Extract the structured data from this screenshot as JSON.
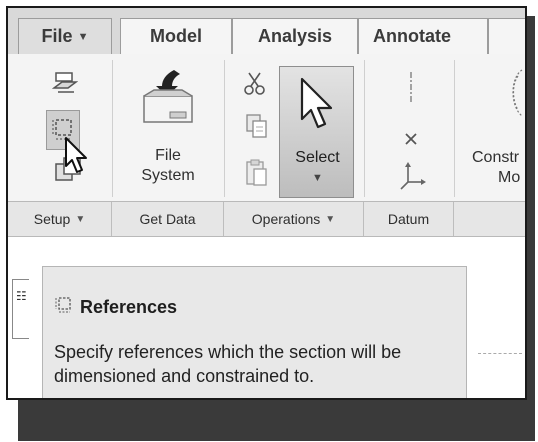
{
  "tabs": [
    {
      "label": "File",
      "has_dropdown": true
    },
    {
      "label": "Model"
    },
    {
      "label": "Analysis"
    },
    {
      "label": "Annotate"
    }
  ],
  "ribbon": {
    "file_system_label": "File System",
    "file_system_line1": "File",
    "file_system_line2": "System",
    "select_label": "Select",
    "construct_partial_1": "Constr",
    "construct_partial_2": "Mo"
  },
  "groups": [
    {
      "label": "Setup",
      "has_dropdown": true
    },
    {
      "label": "Get Data"
    },
    {
      "label": "Operations",
      "has_dropdown": true
    },
    {
      "label": "Datum"
    }
  ],
  "tooltip": {
    "title": "References",
    "body": "Specify references which the section will be dimensioned and constrained to."
  },
  "icons": [
    "sketch-setup-icon",
    "references-icon",
    "sketch-view-icon",
    "file-system-icon",
    "cut-icon",
    "copy-icon",
    "paste-icon",
    "select-arrow-icon",
    "centerline-icon",
    "point-icon",
    "coordinate-system-icon",
    "mouse-cursor-icon"
  ]
}
